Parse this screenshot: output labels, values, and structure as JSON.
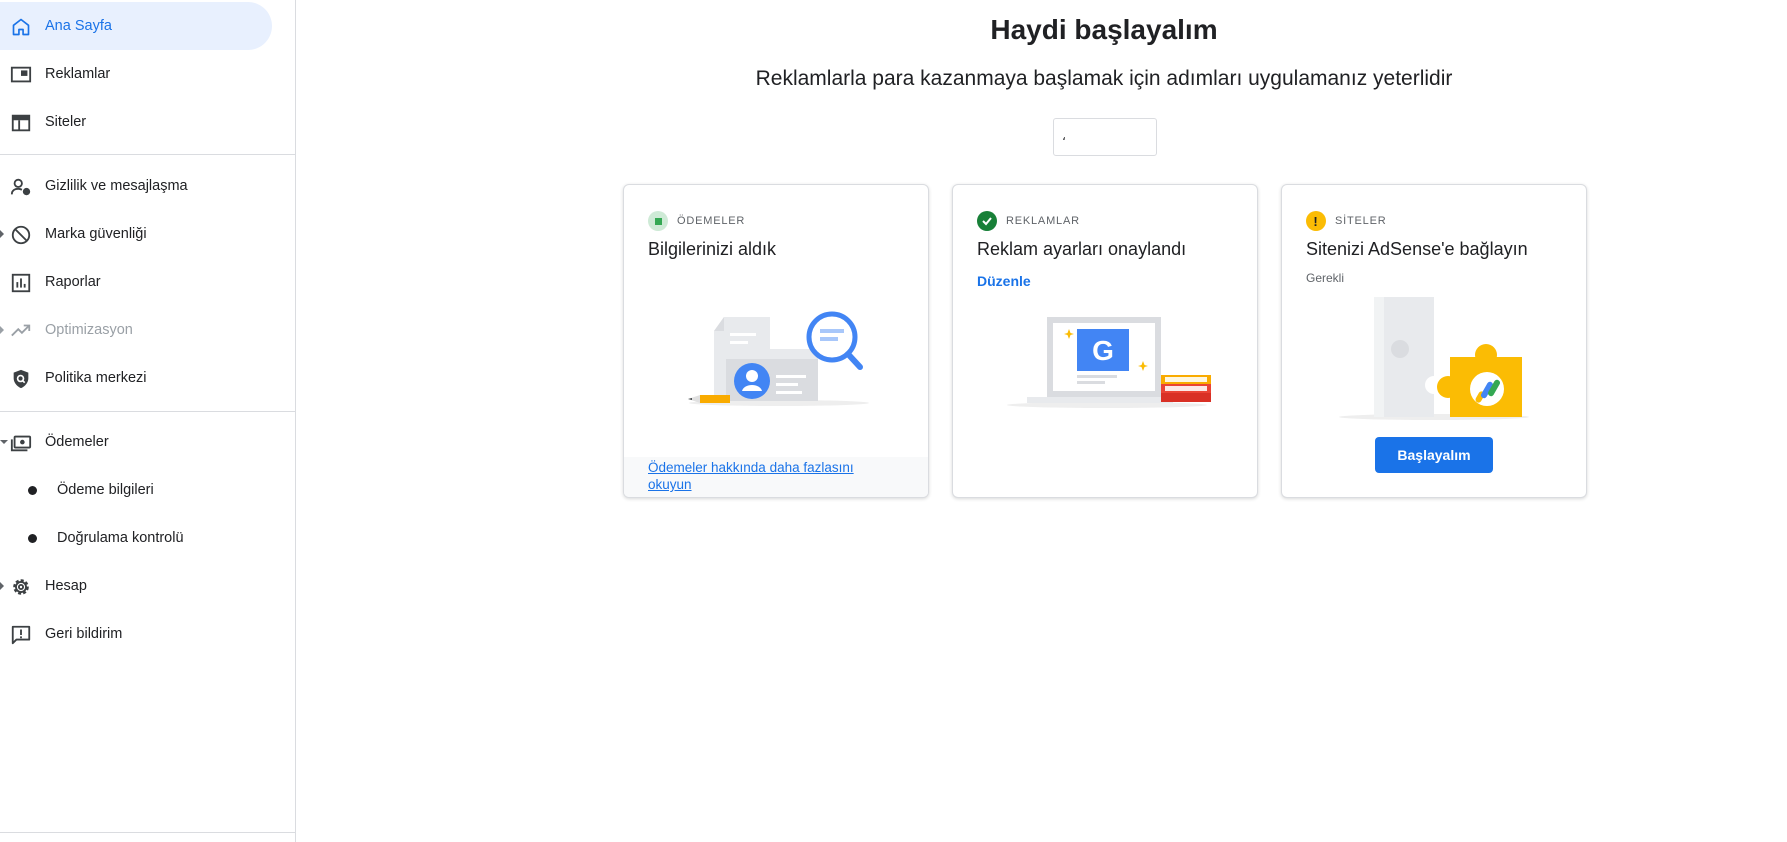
{
  "sidebar": {
    "items": [
      {
        "label": "Ana Sayfa",
        "icon": "home-icon",
        "active": true
      },
      {
        "label": "Reklamlar",
        "icon": "ads-icon"
      },
      {
        "label": "Siteler",
        "icon": "sites-icon"
      },
      {
        "label": "Gizlilik ve mesajlaşma",
        "icon": "privacy-icon"
      },
      {
        "label": "Marka güvenliği",
        "icon": "block-icon"
      },
      {
        "label": "Raporlar",
        "icon": "reports-icon"
      },
      {
        "label": "Optimizasyon",
        "icon": "trending-icon",
        "disabled": true
      },
      {
        "label": "Politika merkezi",
        "icon": "policy-shield-icon"
      },
      {
        "label": "Ödemeler",
        "icon": "payments-icon"
      },
      {
        "label": "Hesap",
        "icon": "gear-icon"
      },
      {
        "label": "Geri bildirim",
        "icon": "feedback-icon"
      }
    ],
    "payments_sub": [
      {
        "label": "Ödeme bilgileri"
      },
      {
        "label": "Doğrulama kontrolü"
      }
    ]
  },
  "main": {
    "title": "Haydi başlayalım",
    "subtitle": "Reklamlarla para kazanmaya başlamak için adımları uygulamanız yeterlidir",
    "select_value": "،"
  },
  "cards": [
    {
      "tag": "ÖDEMELER",
      "title": "Bilgilerinizi aldık",
      "footer_link": "Ödemeler hakkında daha fazlasını okuyun",
      "status_color": "#34a853"
    },
    {
      "tag": "REKLAMLAR",
      "title": "Reklam ayarları onaylandı",
      "action_link": "Düzenle",
      "status_color": "#188038"
    },
    {
      "tag": "SİTELER",
      "title": "Sitenizi AdSense'e bağlayın",
      "note": "Gerekli",
      "button": "Başlayalım",
      "status_color": "#fbbc04"
    }
  ],
  "colors": {
    "accent": "#1a73e8",
    "active_bg": "#e8f0fe"
  }
}
